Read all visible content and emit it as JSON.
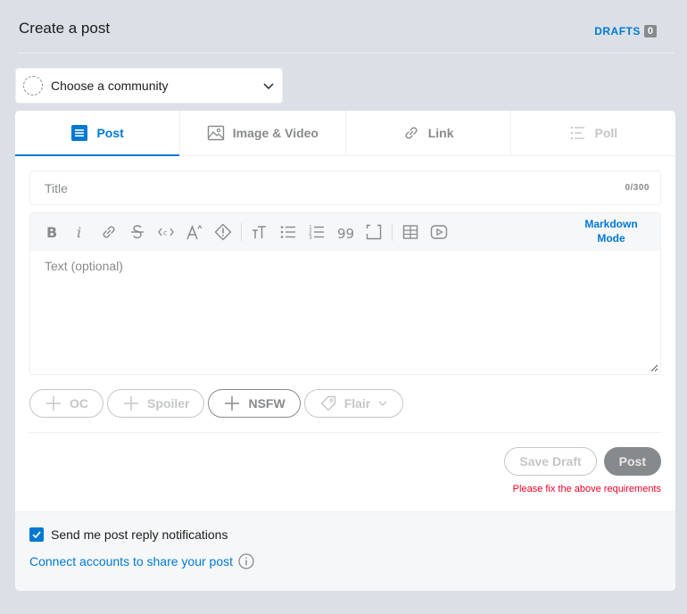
{
  "header": {
    "title": "Create a post",
    "drafts_label": "DRAFTS",
    "drafts_count": "0"
  },
  "community": {
    "placeholder": "Choose a community"
  },
  "tabs": [
    {
      "label": "Post",
      "icon": "post-icon",
      "state": "active"
    },
    {
      "label": "Image & Video",
      "icon": "image-icon",
      "state": "normal"
    },
    {
      "label": "Link",
      "icon": "link-icon",
      "state": "normal"
    },
    {
      "label": "Poll",
      "icon": "poll-icon",
      "state": "disabled"
    }
  ],
  "title_field": {
    "placeholder": "Title",
    "counter": "0/300"
  },
  "editor": {
    "toolbar": [
      "bold-icon",
      "italic-icon",
      "link-icon",
      "strikethrough-icon",
      "inline-code-icon",
      "superscript-icon",
      "spoiler-icon",
      "heading-icon",
      "bulleted-list-icon",
      "numbered-list-icon",
      "quote-icon",
      "code-block-icon",
      "table-icon",
      "video-icon"
    ],
    "markdown_line1": "Markdown",
    "markdown_line2": "Mode",
    "placeholder": "Text (optional)"
  },
  "tags": [
    {
      "label": "OC",
      "state": "disabled"
    },
    {
      "label": "Spoiler",
      "state": "disabled"
    },
    {
      "label": "NSFW",
      "state": "enabled"
    },
    {
      "label": "Flair",
      "state": "disabled"
    }
  ],
  "actions": {
    "save_draft": "Save Draft",
    "post": "Post",
    "error": "Please fix the above requirements"
  },
  "footer": {
    "notify_label": "Send me post reply notifications",
    "notify_checked": true,
    "connect_label": "Connect accounts to share your post"
  },
  "colors": {
    "accent": "#0079d3",
    "error": "#ea0027",
    "disabled": "#c4c6c8",
    "muted": "#878a8c",
    "background": "#dae0e6"
  }
}
